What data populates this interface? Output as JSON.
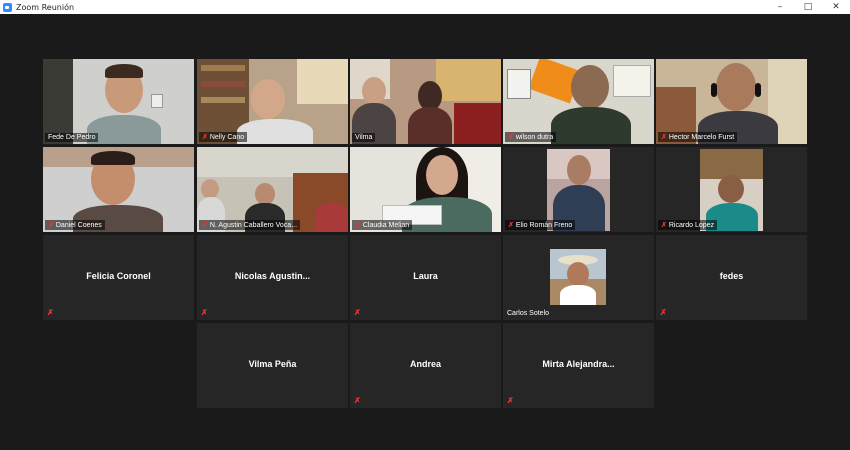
{
  "window": {
    "title": "Zoom Reunión",
    "controls": {
      "minimize": "–",
      "maximize": "□",
      "close": "✕"
    }
  },
  "participants": [
    {
      "name": "Fede De Pedro",
      "muted": false,
      "video": true,
      "active": true
    },
    {
      "name": "Nelly Cano",
      "muted": true,
      "video": true
    },
    {
      "name": "Vilma",
      "muted": false,
      "video": true
    },
    {
      "name": "wilson dutra",
      "muted": true,
      "video": true
    },
    {
      "name": "Hector Marcelo Furst",
      "muted": true,
      "video": true
    },
    {
      "name": "Daniel Coenes",
      "muted": true,
      "video": true
    },
    {
      "name": "N. Agustin Caballero Voca...",
      "muted": true,
      "video": true
    },
    {
      "name": "Claudia Melian",
      "muted": true,
      "video": true
    },
    {
      "name": "Elio Román Freno",
      "muted": true,
      "video": true
    },
    {
      "name": "Ricardo Lopez",
      "muted": true,
      "video": true
    },
    {
      "name": "Felicia Coronel",
      "muted": true,
      "video": false
    },
    {
      "name": "Nicolas Agustin...",
      "muted": true,
      "video": false
    },
    {
      "name": "Laura",
      "muted": true,
      "video": false
    },
    {
      "name": "Carlos Sotelo",
      "muted": false,
      "video": false,
      "photo": true
    },
    {
      "name": "fedes",
      "muted": true,
      "video": false
    },
    {
      "name": "Vilma Peña",
      "muted": false,
      "video": false
    },
    {
      "name": "Andrea",
      "muted": true,
      "video": false
    },
    {
      "name": "Mirta Alejandra...",
      "muted": true,
      "video": false
    }
  ],
  "icons": {
    "mic_muted": "mic-muted-icon",
    "app": "zoom-app-icon"
  },
  "colors": {
    "active_speaker_border": "#d6e24a",
    "muted_mic": "#e33333",
    "tile_background": "#262626",
    "background": "#1a1a1a"
  }
}
